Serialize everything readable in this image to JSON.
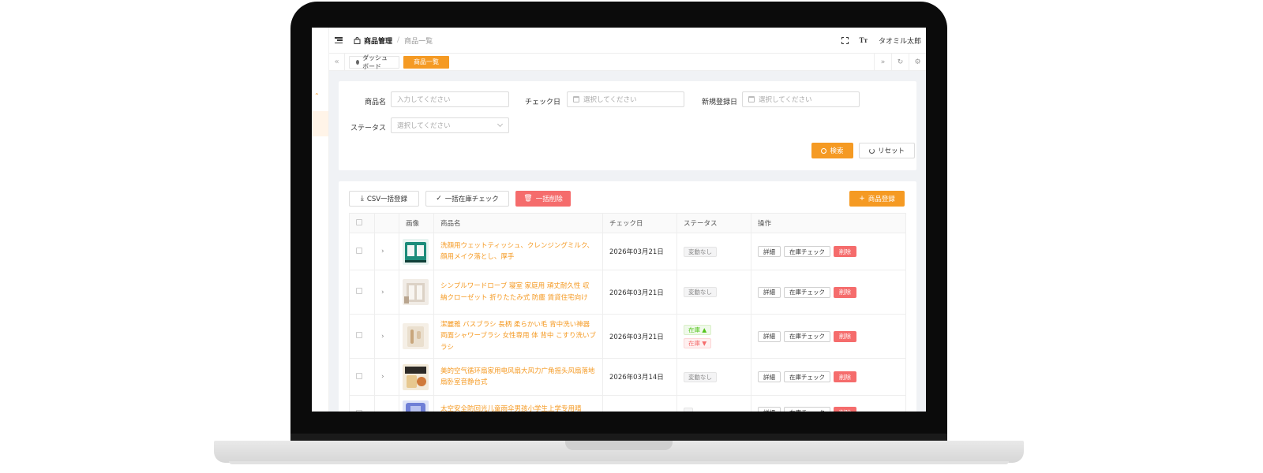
{
  "header": {
    "breadcrumb_main": "商品管理",
    "breadcrumb_sub": "商品一覧",
    "user_name": "タオミル太郎",
    "font_icon_label": "Tт"
  },
  "tabs": {
    "home": "ダッシュボード",
    "active": "商品一覧"
  },
  "filters": {
    "name_label": "商品名",
    "name_placeholder": "入力してください",
    "check_label": "チェック日",
    "check_placeholder": "選択してください",
    "reg_label": "新規登録日",
    "reg_placeholder": "選択してください",
    "status_label": "ステータス",
    "status_placeholder": "選択してください",
    "search_btn": "検索",
    "reset_btn": "リセット"
  },
  "toolbar": {
    "csv": "CSV一括登録",
    "check": "一括在庫チェック",
    "delete": "一括削除",
    "add": "商品登録"
  },
  "columns": [
    "画像",
    "商品名",
    "チェック日",
    "ステータス",
    "操作"
  ],
  "actions": {
    "detail": "詳細",
    "check": "在庫チェック",
    "delete": "削除"
  },
  "rows": [
    {
      "name": "洗顔用ウェットティッシュ、クレンジングミルク、顔用メイク落とし、厚手",
      "date": "2026年03月21日",
      "status": "変動なし"
    },
    {
      "name": "シンプルワードローブ 寝室 家庭用 頑丈耐久性 収納クローゼット 折りたたみ式 防塵 賃貸住宅向け",
      "date": "2026年03月21日",
      "status": "変動なし"
    },
    {
      "name": "潔麗雅 バスブラシ 長柄 柔らかい毛 背中洗い神器 両面シャワーブラシ 女性専用 体 背中 こすり洗いブラシ",
      "date": "2026年03月21日",
      "status_up": "在庫 ▲",
      "status_down": "在庫 ▼"
    },
    {
      "name": "美的空气循环扇家用电风扇大风力广角摇头风扇落地扇卧室音静台式",
      "date": "2026年03月14日",
      "status": "変動なし"
    },
    {
      "name": "太空安全防回光儿童雨伞男孩小学生上学专用晴",
      "date": "",
      "status": ""
    }
  ],
  "colors": {
    "accent": "#f59a23",
    "danger": "#f56c6c"
  }
}
